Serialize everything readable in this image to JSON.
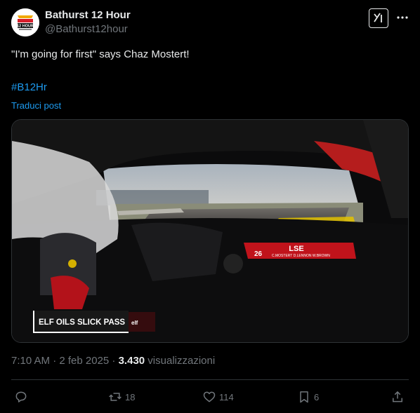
{
  "tweet": {
    "author_name": "Bathurst 12 Hour",
    "author_handle": "@Bathurst12hour",
    "text": "\"I'm going for first\" says Chaz Mostert!",
    "hashtag": "#B12Hr",
    "translate_label": "Traduci post",
    "timestamp": "7:10 AM · 2 feb 2025 · ",
    "views_count": "3.430",
    "views_label": " visualizzazioni"
  },
  "avatar_logo_text": [
    "BATHURST",
    "12 HOUR"
  ],
  "video": {
    "overlay_label": "ELF OILS SLICK PASS",
    "overlay_logo": "elf",
    "car_number": "26",
    "car_names": "C.MOSTERT  D.LENNON  W.BROWN",
    "dash_logo": "LSE"
  },
  "actions": {
    "replies": "",
    "reposts": "18",
    "likes": "114",
    "bookmarks": "6"
  },
  "colors": {
    "accent": "#1d9bf0",
    "muted": "#71767b",
    "text": "#e7e9ea",
    "border": "#2f3336"
  },
  "icons": [
    "grok-icon",
    "more-icon",
    "reply-icon",
    "repost-icon",
    "like-icon",
    "bookmark-icon",
    "share-icon"
  ]
}
